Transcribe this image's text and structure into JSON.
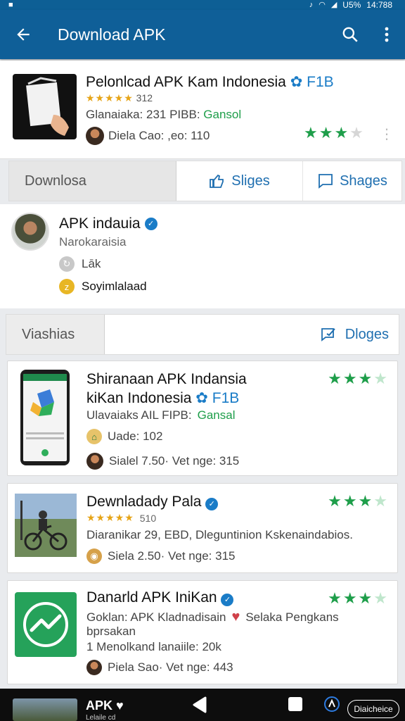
{
  "status_bar": {
    "time": "14:788",
    "battery": "U5%"
  },
  "app_bar": {
    "title": "Download APK"
  },
  "main_app": {
    "title": "Pelonlcad APK Kam Indonesia",
    "badge": "F1B",
    "rating_stars": "★★★★★",
    "rating_count": "312",
    "meta_prefix": "Glanaiaka: 231 PIBB:",
    "meta_green": "Gansol",
    "developer": "Diela Cao: ,eo: 110",
    "stars_rating": 3
  },
  "tabs": {
    "download": "Downlosa",
    "likes": "Sliges",
    "shares": "Shages"
  },
  "profile": {
    "name": "APK indauia",
    "subtitle": "Narokaraisia",
    "row1": "Lāk",
    "row2": "Soyimlalaad"
  },
  "tabs2": {
    "views": "Viashias",
    "blogs": "Dloges"
  },
  "list": [
    {
      "title_line1": "Shiranaan APK Indansia",
      "title_line2": "kiKan Indonesia",
      "badge": "F1B",
      "meta_prefix": "Ulavaiaks AIL FIPB:",
      "meta_green": "Gansal",
      "row1": "Uade: 102",
      "row2": "Sialel 7.50· Vet nge: 315",
      "stars_rating": 3
    },
    {
      "title_line1": "Dewnladady Pala",
      "rating_stars": "★★★★★",
      "rating_count": "510",
      "row1": "Diaranikar 29, EBD, Dleguntinion Kskenaindabios.",
      "row2": "Siela 2.50· Vet nge: 315",
      "stars_rating": 3
    },
    {
      "title_line1": "Danarld APK IniKan",
      "row1_prefix": "Goklan: APK Kladnadisain",
      "row1_suffix": "Selaka Pengkans",
      "row1b": "bprsakan",
      "row2": "1 Menolkand lanaiile: 20k",
      "row3": "Piela Sao· Vet nge: 443",
      "stars_rating": 3
    }
  ],
  "bottom_nav": {
    "label": "APK",
    "sub": "Lelaile cd",
    "pill": "Diaicheice"
  },
  "colors": {
    "primary": "#0f5f98",
    "accent_green": "#1e9e4a",
    "link_blue": "#1f6fb0"
  }
}
